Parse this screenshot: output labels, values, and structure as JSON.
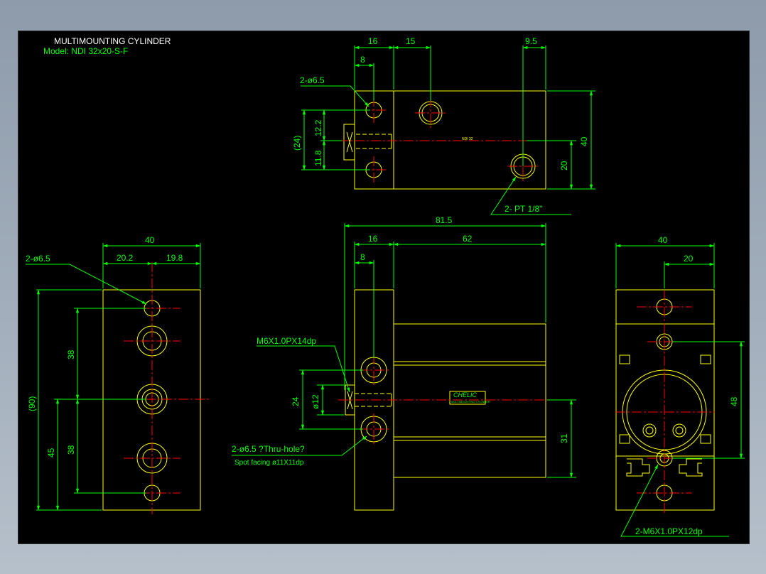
{
  "title_block": {
    "title": "MULTIMOUNTING CYLINDER",
    "model": "Model: NDI 32x20-S-F"
  },
  "top_view": {
    "dims": [
      "16",
      "15",
      "9.5",
      "8",
      "12.2",
      "11.8",
      "(24)",
      "40",
      "20"
    ],
    "hole_note": "2-ø6.5",
    "port_note": "2- PT 1/8\"",
    "marking": "NDI 32"
  },
  "left_view": {
    "dims": [
      "40",
      "20.2",
      "19.8",
      "38",
      "38",
      "(90)",
      "45"
    ],
    "hole_note": "2-ø6.5"
  },
  "front_view": {
    "dims": [
      "81.5",
      "16",
      "62",
      "8",
      "24",
      "ø12",
      "31"
    ],
    "thread_note": "M6X1.0PX14dp",
    "hole_note": "2-ø6.5 ?Thru-hole?",
    "spot_note": "Spot facing  ø11X11dp",
    "brand": "CHELIC",
    "brand_sub": "MULTIMOUNTING CYLINDER"
  },
  "right_view": {
    "dims": [
      "40",
      "20",
      "48"
    ],
    "thread_note": "2-M6X1.0PX12dp"
  },
  "colors": {
    "background": "#000000",
    "outline": "#ffff00",
    "dimension": "#00ff00",
    "centerline": "#ff0000",
    "text": "#ffffff"
  }
}
